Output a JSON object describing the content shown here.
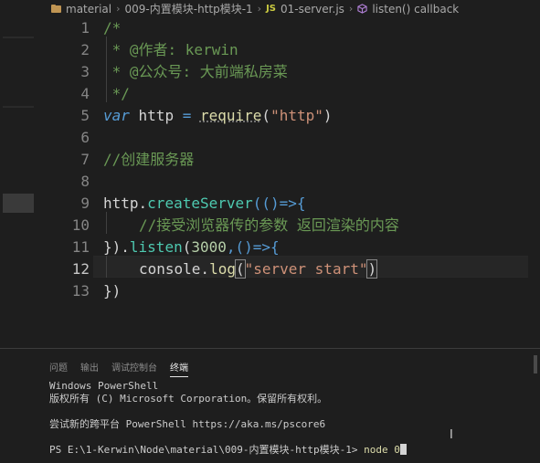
{
  "breadcrumb": {
    "items": [
      "material",
      "009-内置模块-http模块-1",
      "01-server.js",
      "listen() callback"
    ],
    "file_type": "JS"
  },
  "editor": {
    "line_numbers": [
      "1",
      "2",
      "3",
      "4",
      "5",
      "6",
      "7",
      "8",
      "9",
      "10",
      "11",
      "12",
      "13"
    ],
    "lines": {
      "l1": "/*",
      "l2": " * @作者: kerwin",
      "l3": " * @公众号: 大前端私房菜",
      "l4": " */",
      "l5_kw": "var",
      "l5_var": " http ",
      "l5_eq": "=",
      "l5_req": "require",
      "l5_str": "\"http\"",
      "l7": "//创建服务器",
      "l9_obj": "http.",
      "l9_fn": "createServer",
      "l9_arrow": "(()=>{",
      "l10": "//接受浏览器传的参数 返回渲染的内容",
      "l11_a": "}).",
      "l11_fn": "listen",
      "l11_num": "3000",
      "l11_rest": ",()=>{",
      "l12_obj": "console.",
      "l12_fn": "log",
      "l12_str": "\"server start\"",
      "l13": "})"
    }
  },
  "panel": {
    "tabs": [
      "问题",
      "输出",
      "调试控制台",
      "终端"
    ],
    "active_tab": "终端",
    "terminal": {
      "line1": "Windows PowerShell",
      "line2": "版权所有 (C) Microsoft Corporation。保留所有权利。",
      "line3": "尝试新的跨平台 PowerShell https://aka.ms/pscore6",
      "prompt": "PS E:\\1-Kerwin\\Node\\material\\009-内置模块-http模块-1> ",
      "command": "node 0"
    }
  },
  "colors": {
    "background": "#1e1e1e",
    "comment": "#6a9955",
    "keyword": "#569cd6",
    "string": "#ce9178",
    "function": "#dcdcaa",
    "number": "#b5cea8"
  }
}
